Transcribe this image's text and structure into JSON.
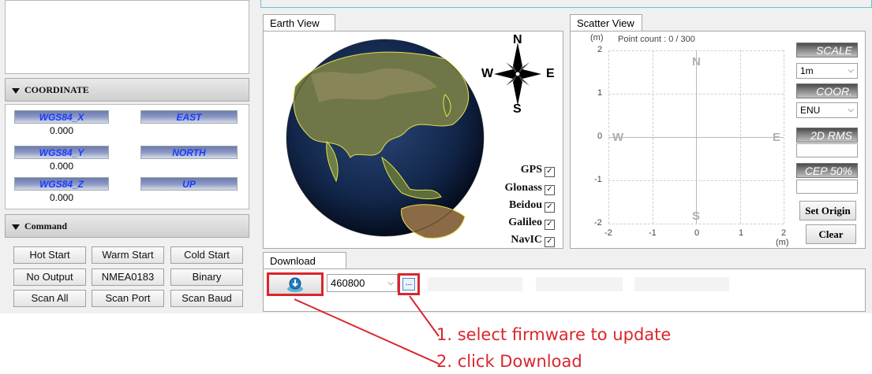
{
  "coordinate": {
    "title": "COORDINATE",
    "fields": [
      {
        "label": "WGS84_X",
        "value": "0.000"
      },
      {
        "label": "EAST",
        "value": ""
      },
      {
        "label": "WGS84_Y",
        "value": "0.000"
      },
      {
        "label": "NORTH",
        "value": ""
      },
      {
        "label": "WGS84_Z",
        "value": "0.000"
      },
      {
        "label": "UP",
        "value": ""
      }
    ]
  },
  "command": {
    "title": "Command",
    "buttons": [
      "Hot Start",
      "Warm Start",
      "Cold Start",
      "No Output",
      "NMEA0183",
      "Binary",
      "Scan All",
      "Scan Port",
      "Scan Baud"
    ]
  },
  "earth_view": {
    "tab": "Earth View",
    "compass": {
      "n": "N",
      "s": "S",
      "e": "E",
      "w": "W"
    },
    "constellations": [
      {
        "name": "GPS",
        "checked": true
      },
      {
        "name": "Glonass",
        "checked": true
      },
      {
        "name": "Beidou",
        "checked": true
      },
      {
        "name": "Galileo",
        "checked": true
      },
      {
        "name": "NavIC",
        "checked": true
      }
    ]
  },
  "scatter_view": {
    "tab": "Scatter View",
    "unit_top": "(m)",
    "point_count": "Point count : 0 / 300",
    "y_ticks": [
      "2",
      "1",
      "0",
      "-1",
      "-2"
    ],
    "x_ticks": [
      "-2",
      "-1",
      "0",
      "1",
      "2"
    ],
    "unit_bottom": "(m)",
    "dir_n": "N",
    "dir_s": "S",
    "dir_e": "E",
    "dir_w": "W",
    "scale_label": "SCALE",
    "scale_value": "1m",
    "coor_label": "COOR.",
    "coor_value": "ENU",
    "rms_label": "2D RMS",
    "rms_value": "",
    "cep_label": "CEP 50%",
    "cep_value": "",
    "set_origin": "Set Origin",
    "clear": "Clear"
  },
  "download": {
    "tab": "Download",
    "baud": "460800",
    "browse": "..."
  },
  "annotations": {
    "step1": "1. select firmware to update",
    "step2": "2. click Download"
  },
  "colors": {
    "annotation_red": "#d9262c",
    "coord_label_text": "#1a3cff",
    "accent_cyan": "#68c2d9"
  }
}
